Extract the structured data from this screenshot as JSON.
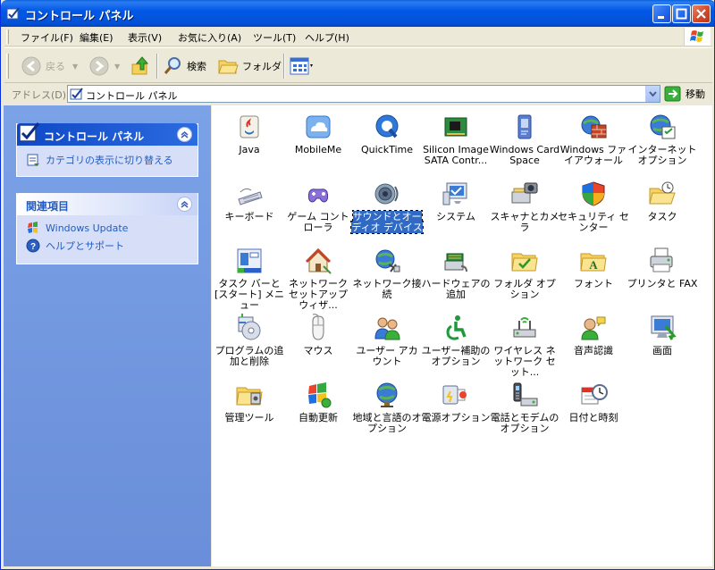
{
  "window": {
    "title": "コントロール パネル"
  },
  "menu": {
    "items": [
      "ファイル(F)",
      "編集(E)",
      "表示(V)",
      "お気に入り(A)",
      "ツール(T)",
      "ヘルプ(H)"
    ]
  },
  "toolbar": {
    "back": "戻る",
    "search": "検索",
    "folders": "フォルダ"
  },
  "address": {
    "label": "アドレス(D)",
    "value": "コントロール パネル",
    "go": "移動"
  },
  "left_pane": {
    "control_panel": {
      "title": "コントロール パネル",
      "switch_view": "カテゴリの表示に切り替える"
    },
    "related": {
      "title": "関連項目",
      "links": [
        "Windows Update",
        "ヘルプとサポート"
      ]
    }
  },
  "items": [
    {
      "label": "Java",
      "icon": "java-icon"
    },
    {
      "label": "MobileMe",
      "icon": "mobileme-icon"
    },
    {
      "label": "QuickTime",
      "icon": "quicktime-icon"
    },
    {
      "label": "Silicon Image SATA Contr...",
      "icon": "sata-controller-icon"
    },
    {
      "label": "Windows CardSpace",
      "icon": "cardspace-icon"
    },
    {
      "label": "Windows ファイアウォール",
      "icon": "firewall-icon"
    },
    {
      "label": "インターネット オプション",
      "icon": "internet-options-icon"
    },
    {
      "label": "キーボード",
      "icon": "keyboard-icon"
    },
    {
      "label": "ゲーム コントローラ",
      "icon": "game-controller-icon"
    },
    {
      "label": "サウンドとオーディオ デバイス",
      "icon": "sound-icon",
      "selected": true
    },
    {
      "label": "システム",
      "icon": "system-icon"
    },
    {
      "label": "スキャナとカメラ",
      "icon": "scanner-camera-icon"
    },
    {
      "label": "セキュリティ センター",
      "icon": "security-center-icon"
    },
    {
      "label": "タスク",
      "icon": "tasks-icon"
    },
    {
      "label": "タスク バーと [スタート] メニュー",
      "icon": "taskbar-icon"
    },
    {
      "label": "ネットワーク セットアップ ウィザ...",
      "icon": "network-setup-icon"
    },
    {
      "label": "ネットワーク接続",
      "icon": "network-connections-icon"
    },
    {
      "label": "ハードウェアの追加",
      "icon": "add-hardware-icon"
    },
    {
      "label": "フォルダ オプション",
      "icon": "folder-options-icon"
    },
    {
      "label": "フォント",
      "icon": "fonts-icon"
    },
    {
      "label": "プリンタと FAX",
      "icon": "printers-fax-icon"
    },
    {
      "label": "プログラムの追加と削除",
      "icon": "add-remove-programs-icon"
    },
    {
      "label": "マウス",
      "icon": "mouse-icon"
    },
    {
      "label": "ユーザー アカウント",
      "icon": "user-accounts-icon"
    },
    {
      "label": "ユーザー補助のオプション",
      "icon": "accessibility-icon"
    },
    {
      "label": "ワイヤレス ネットワーク セット...",
      "icon": "wireless-setup-icon"
    },
    {
      "label": "音声認識",
      "icon": "speech-recognition-icon"
    },
    {
      "label": "画面",
      "icon": "display-icon"
    },
    {
      "label": "管理ツール",
      "icon": "admin-tools-icon"
    },
    {
      "label": "自動更新",
      "icon": "automatic-updates-icon"
    },
    {
      "label": "地域と言語のオプション",
      "icon": "regional-language-icon"
    },
    {
      "label": "電源オプション",
      "icon": "power-options-icon"
    },
    {
      "label": "電話とモデムのオプション",
      "icon": "phone-modem-icon"
    },
    {
      "label": "日付と時刻",
      "icon": "date-time-icon"
    }
  ]
}
